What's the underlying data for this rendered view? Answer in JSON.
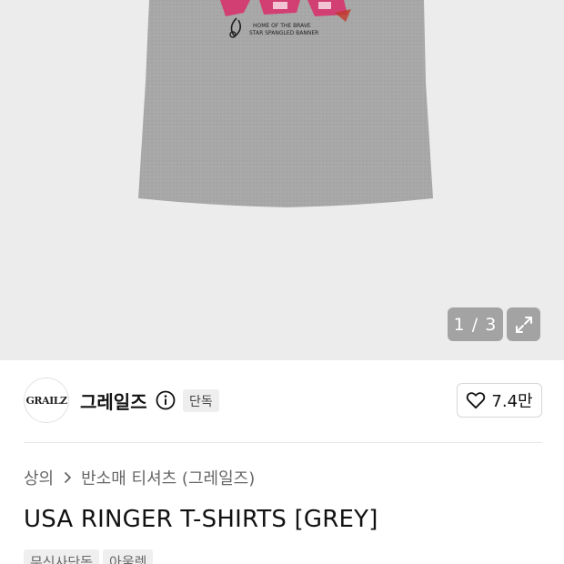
{
  "gallery": {
    "counter": "1 / 3",
    "graphic_text": [
      "HOME OF THE BRAVE",
      "STAR SPANGLED BANNER"
    ]
  },
  "brand": {
    "logo_text": "GRAILZ",
    "name": "그레일즈",
    "badge": "단독",
    "likes": "7.4만"
  },
  "breadcrumb": {
    "category": "상의",
    "subcategory": "반소매 티셔츠 (그레일즈)"
  },
  "product": {
    "title": "USA RINGER T-SHIRTS [GREY]",
    "tags": [
      "무신사단독",
      "아울렛"
    ]
  },
  "colors": {
    "hero_bg": "#ececec",
    "shirt": "#a9a9a9",
    "print_pink": "#d6336c"
  }
}
